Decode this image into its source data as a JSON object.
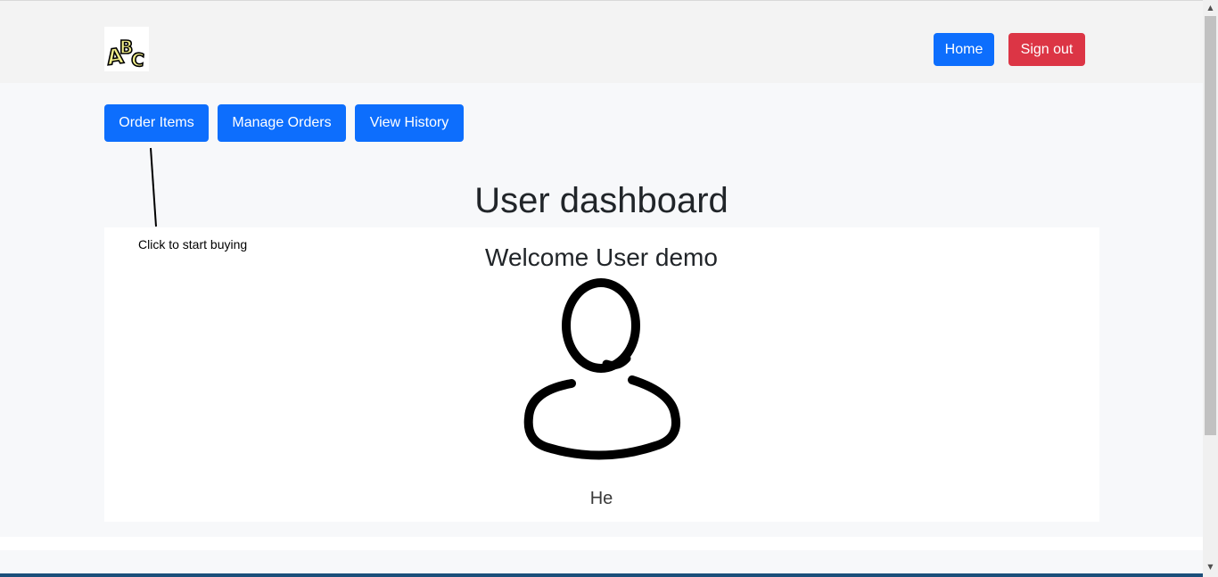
{
  "navbar": {
    "logo_text": "ABC",
    "home_label": "Home",
    "signout_label": "Sign out"
  },
  "actions": {
    "order_items_label": "Order Items",
    "manage_orders_label": "Manage Orders",
    "view_history_label": "View History"
  },
  "annotation": {
    "text": "Click to start buying"
  },
  "dashboard": {
    "title": "User dashboard",
    "welcome": "Welcome User demo",
    "avatar_icon": "user-silhouette-icon",
    "bio": "He"
  },
  "colors": {
    "primary": "#0d6efd",
    "danger": "#dc3545",
    "navbar_bg": "#f3f3f3",
    "page_bg": "#f7f8fa"
  }
}
